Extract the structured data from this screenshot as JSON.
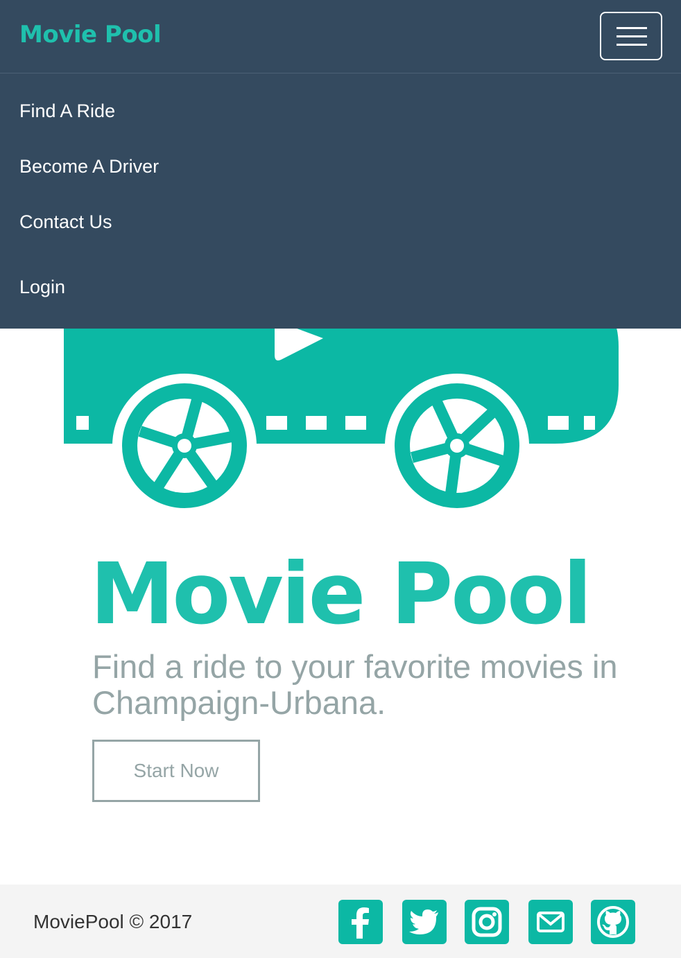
{
  "navbar": {
    "brand": "Movie Pool",
    "menu_toggle": "hamburger-menu-icon",
    "items": [
      {
        "label": "Find A Ride"
      },
      {
        "label": "Become A Driver"
      },
      {
        "label": "Contact Us"
      },
      {
        "label": "Login"
      }
    ]
  },
  "hero": {
    "title": "Movie Pool",
    "tagline": "Find a ride to your favorite movies in Champaign-Urbana.",
    "cta_label": "Start Now",
    "illustration": "film-car-logo"
  },
  "footer": {
    "copyright": "MoviePool © 2017",
    "social": [
      {
        "name": "facebook-icon"
      },
      {
        "name": "twitter-icon"
      },
      {
        "name": "instagram-icon"
      },
      {
        "name": "email-icon"
      },
      {
        "name": "github-icon"
      }
    ]
  },
  "colors": {
    "navbar_bg": "#344a5f",
    "accent": "#1fc0ad",
    "car": "#0cb8a4",
    "muted_text": "#95a5a6",
    "footer_bg": "#f4f4f4"
  }
}
